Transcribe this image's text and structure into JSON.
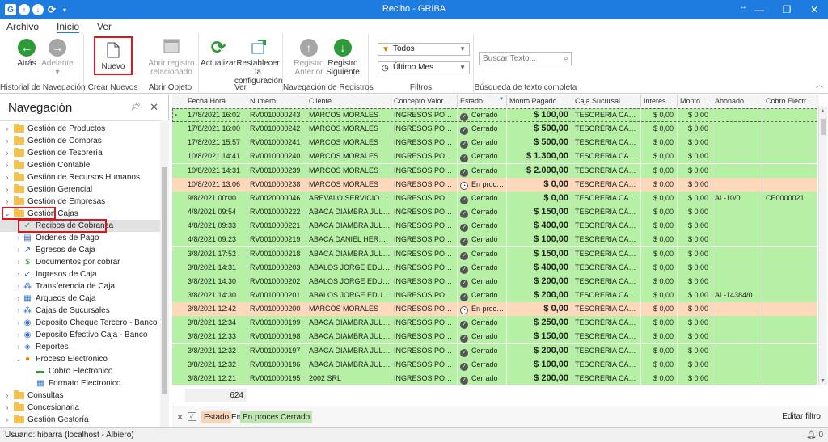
{
  "window": {
    "title": "Recibo - GRIBA"
  },
  "menu": {
    "tabs": [
      "Archivo",
      "Inicio",
      "Ver"
    ]
  },
  "ribbon": {
    "historial": {
      "label": "Historial de Navegación",
      "atras": "Atrás",
      "adelante": "Adelante"
    },
    "crear": {
      "label": "Crear Nuevos",
      "nuevo": "Nuevo"
    },
    "abrir": {
      "label": "Abrir Objeto",
      "abrir_reg_1": "Abrir registro",
      "abrir_reg_2": "relacionado"
    },
    "ver": {
      "label": "Ver",
      "actualizar": "Actualizar",
      "restablecer_1": "Restablecer la",
      "restablecer_2": "configuración"
    },
    "navegacion": {
      "label": "Navegación de Registros",
      "anterior_1": "Registro",
      "anterior_2": "Anterior",
      "siguiente_1": "Registro",
      "siguiente_2": "Siguiente"
    },
    "filtros": {
      "label": "Filtros",
      "combo1": "Todos",
      "combo2": "Último Mes"
    },
    "busqueda": {
      "label": "Búsqueda de texto completa",
      "placeholder": "Buscar Texto..."
    }
  },
  "nav": {
    "title": "Navegación",
    "folders_top": [
      "Gestión de Productos",
      "Gestión de Compras",
      "Gestión de Tesorería",
      "Gestión Contable",
      "Gestión de Recursos Humanos",
      "Gestión Gerencial",
      "Gestión de Empresas",
      "Gestión Cajas"
    ],
    "cajas_items": [
      "Recibos de Cobranza",
      "Ordenes de Pago",
      "Egresos de Caja",
      "Documentos por cobrar",
      "Ingresos de Caja",
      "Transferencia de Caja",
      "Arqueos de Caja",
      "Cajas de Sucursales",
      "Deposito Cheque Tercero - Banco",
      "Deposito Efectivo Caja - Banco",
      "Reportes",
      "Proceso Electronico"
    ],
    "proceso_items": [
      "Cobro Electronico",
      "Formato Electronico"
    ],
    "folders_bottom": [
      "Consultas",
      "Concesionaria",
      "Gestión Gestoría"
    ]
  },
  "grid": {
    "columns": [
      "Fecha Hora",
      "Numero",
      "Cliente",
      "Concepto Valor",
      "Estado",
      "Monto Pagado",
      "Caja Sucursal",
      "Interes...",
      "Monto...",
      "Abonado",
      "Cobro Electronico"
    ],
    "rows": [
      [
        "17/8/2021 16:02",
        "RV0010000243",
        "MARCOS MORALES",
        "INGRESOS POR VE...",
        "Cerrado",
        "$ 100,00",
        "TESORERIA CASA C...",
        "$ 0,00",
        "$ 0,00",
        "",
        ""
      ],
      [
        "17/8/2021 16:00",
        "RV0010000242",
        "MARCOS MORALES",
        "INGRESOS POR VE...",
        "Cerrado",
        "$ 500,00",
        "TESORERIA CASA C...",
        "$ 0,00",
        "$ 0,00",
        "",
        ""
      ],
      [
        "17/8/2021 15:57",
        "RV0010000241",
        "MARCOS MORALES",
        "INGRESOS POR VE...",
        "Cerrado",
        "$ 500,00",
        "TESORERIA CASA C...",
        "$ 0,00",
        "$ 0,00",
        "",
        ""
      ],
      [
        "10/8/2021 14:41",
        "RV0010000240",
        "MARCOS MORALES",
        "INGRESOS POR VE...",
        "Cerrado",
        "$ 1.300,00",
        "TESORERIA CASA C...",
        "$ 0,00",
        "$ 0,00",
        "",
        ""
      ],
      [
        "10/8/2021 14:31",
        "RV0010000239",
        "MARCOS MORALES",
        "INGRESOS POR VE...",
        "Cerrado",
        "$ 2.000,00",
        "TESORERIA CASA C...",
        "$ 0,00",
        "$ 0,00",
        "",
        ""
      ],
      [
        "10/8/2021 13:06",
        "RV0010000238",
        "MARCOS MORALES",
        "INGRESOS POR VE...",
        "En proceso",
        "$ 0,00",
        "TESORERIA CASA C...",
        "$ 0,00",
        "$ 0,00",
        "",
        ""
      ],
      [
        "9/8/2021 00:00",
        "RV0020000046",
        "AREVALO SERVICIOS SO...",
        "INGRESOS POR VE...",
        "Cerrado",
        "$ 0,00",
        "TESORERIA CASA C...",
        "$ 0,00",
        "$ 0,00",
        "AL-10/0",
        "CE0000021"
      ],
      [
        "4/8/2021 09:54",
        "RV0010000222",
        "ABACA DIAMBRA JULIETA",
        "INGRESOS POR VE...",
        "Cerrado",
        "$ 150,00",
        "TESORERIA CASA C...",
        "$ 0,00",
        "$ 0,00",
        "",
        ""
      ],
      [
        "4/8/2021 09:33",
        "RV0010000221",
        "ABACA DIAMBRA JULIETA",
        "INGRESOS POR VE...",
        "Cerrado",
        "$ 400,00",
        "TESORERIA CASA C...",
        "$ 0,00",
        "$ 0,00",
        "",
        ""
      ],
      [
        "4/8/2021 09:23",
        "RV0010000219",
        "ABACA DANIEL HERNAN",
        "INGRESOS POR VE...",
        "Cerrado",
        "$ 100,00",
        "TESORERIA CASA C...",
        "$ 0,00",
        "$ 0,00",
        "",
        ""
      ],
      [
        "3/8/2021 17:52",
        "RV0010000218",
        "ABACA DIAMBRA JULIETA",
        "INGRESOS POR VE...",
        "Cerrado",
        "$ 150,00",
        "TESORERIA CASA C...",
        "$ 0,00",
        "$ 0,00",
        "",
        ""
      ],
      [
        "3/8/2021 14:31",
        "RV0010000203",
        "ABALOS JORGE EDUARDO",
        "INGRESOS POR VE...",
        "Cerrado",
        "$ 400,00",
        "TESORERIA CASA C...",
        "$ 0,00",
        "$ 0,00",
        "",
        ""
      ],
      [
        "3/8/2021 14:30",
        "RV0010000202",
        "ABALOS JORGE EDUARDO",
        "INGRESOS POR VE...",
        "Cerrado",
        "$ 200,00",
        "TESORERIA CASA C...",
        "$ 0,00",
        "$ 0,00",
        "",
        ""
      ],
      [
        "3/8/2021 14:30",
        "RV0010000201",
        "ABALOS JORGE EDUARDO",
        "INGRESOS POR VE...",
        "Cerrado",
        "$ 200,00",
        "TESORERIA CASA C...",
        "$ 0,00",
        "$ 0,00",
        "AL-14384/0",
        ""
      ],
      [
        "3/8/2021 12:42",
        "RV0010000200",
        "MARCOS MORALES",
        "INGRESOS POR VE...",
        "En proceso",
        "$ 0,00",
        "TESORERIA CASA C...",
        "$ 0,00",
        "$ 0,00",
        "",
        ""
      ],
      [
        "3/8/2021 12:34",
        "RV0010000199",
        "ABACA DIAMBRA JULIETA",
        "INGRESOS POR VE...",
        "Cerrado",
        "$ 250,00",
        "TESORERIA CASA C...",
        "$ 0,00",
        "$ 0,00",
        "",
        ""
      ],
      [
        "3/8/2021 12:33",
        "RV0010000198",
        "ABACA DIAMBRA JULIETA",
        "INGRESOS POR VE...",
        "Cerrado",
        "$ 150,00",
        "TESORERIA CASA C...",
        "$ 0,00",
        "$ 0,00",
        "",
        ""
      ],
      [
        "3/8/2021 12:32",
        "RV0010000197",
        "ABACA DIAMBRA JULIETA",
        "INGRESOS POR VE...",
        "Cerrado",
        "$ 200,00",
        "TESORERIA CASA C...",
        "$ 0,00",
        "$ 0,00",
        "",
        ""
      ],
      [
        "3/8/2021 12:32",
        "RV0010000196",
        "ABACA DIAMBRA JULIETA",
        "INGRESOS POR VE...",
        "Cerrado",
        "$ 100,00",
        "TESORERIA CASA C...",
        "$ 0,00",
        "$ 0,00",
        "",
        ""
      ],
      [
        "3/8/2021 12:21",
        "RV0010000195",
        "2002 SRL",
        "INGRESOS POR VE...",
        "Cerrado",
        "$ 200,00",
        "TESORERIA CASA C...",
        "$ 0,00",
        "$ 0,00",
        "",
        ""
      ]
    ],
    "count": "624"
  },
  "filterbar": {
    "estado": "Estado",
    "en": "En",
    "proceso": "En proceso",
    "cerrado": "Cerrado",
    "edit": "Editar filtro"
  },
  "status": {
    "user": "Usuario: hibarra",
    "host": "(localhost - Albiero)",
    "notifications": "0"
  },
  "colors": {
    "titlebar": "#1e7be0",
    "row_cerrado": "#b6f0a5",
    "row_proceso": "#fdd8bb",
    "highlight": "#e0141e"
  }
}
